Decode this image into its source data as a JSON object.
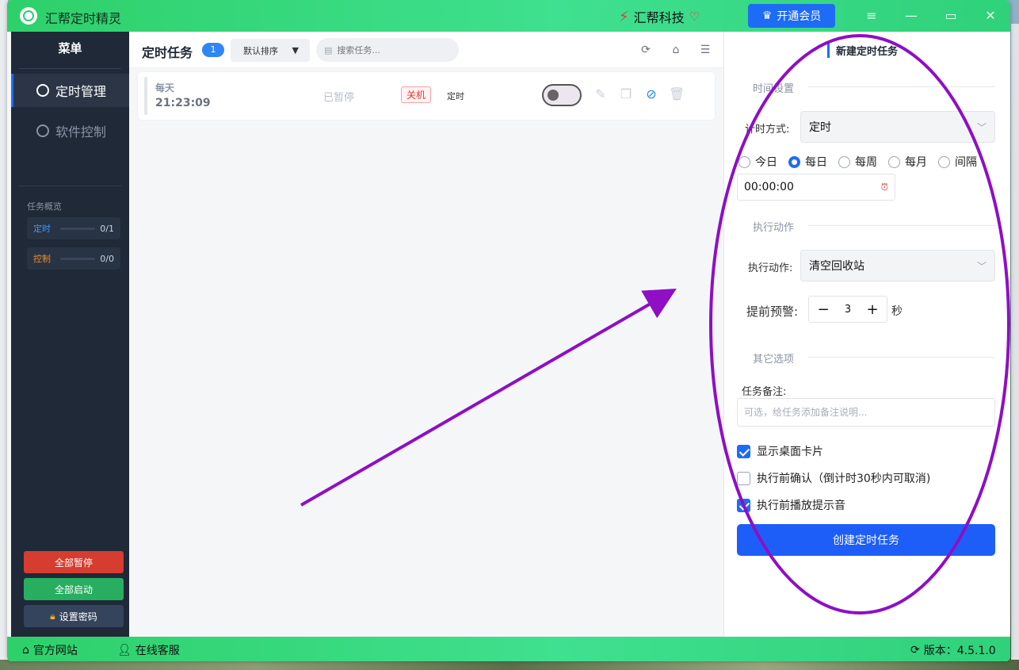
{
  "app": {
    "title": "汇帮定时精灵",
    "brand": "汇帮科技",
    "vip_button": "开通会员",
    "controls": {
      "menu": "≡",
      "minimize": "—",
      "maximize": "▭",
      "close": "✕"
    }
  },
  "sidebar": {
    "title": "菜单",
    "items": [
      {
        "label": "定时管理",
        "icon": "clock-icon",
        "active": true
      },
      {
        "label": "软件控制",
        "icon": "gear-icon",
        "active": false
      }
    ],
    "overview_title": "任务概览",
    "overview": [
      {
        "label": "定时",
        "count": "0/1",
        "color": "#3b9bf5"
      },
      {
        "label": "控制",
        "count": "0/0",
        "color": "#f08a24"
      }
    ],
    "buttons": {
      "pause_all": "全部暂停",
      "start_all": "全部启动",
      "set_password": "设置密码"
    }
  },
  "main": {
    "title": "定时任务",
    "count": "1",
    "sort_label": "默认排序",
    "search_placeholder": "搜索任务...",
    "tasks": [
      {
        "frequency": "每天",
        "time": "21:23:09",
        "status": "已暂停",
        "action": "关机",
        "type": "定时",
        "enabled": false
      }
    ]
  },
  "panel": {
    "title": "新建定时任务",
    "time_section": "时间设置",
    "timing_mode_label": "计时方式:",
    "timing_mode_value": "定时",
    "radios": [
      {
        "label": "今日",
        "checked": false
      },
      {
        "label": "每日",
        "checked": true
      },
      {
        "label": "每周",
        "checked": false
      },
      {
        "label": "每月",
        "checked": false
      },
      {
        "label": "间隔",
        "checked": false
      }
    ],
    "time_value": "00:00:00",
    "action_section": "执行动作",
    "action_label": "执行动作:",
    "action_value": "清空回收站",
    "warning_label": "提前预警:",
    "warning_value": "3",
    "warning_unit": "秒",
    "other_section": "其它选项",
    "remark_label": "任务备注:",
    "remark_placeholder": "可选，给任务添加备注说明...",
    "checks": [
      {
        "label": "显示桌面卡片",
        "checked": true
      },
      {
        "label": "执行前确认（倒计时30秒内可取消)",
        "checked": false
      },
      {
        "label": "执行前播放提示音",
        "checked": true
      }
    ],
    "create_button": "创建定时任务"
  },
  "footer": {
    "website": "官方网站",
    "support": "在线客服",
    "version": "版本：4.5.1.0"
  },
  "colors": {
    "accent": "#1e6cf5",
    "titlebar": "#3fe08f",
    "sidebar": "#1f2937",
    "danger": "#d63c2f",
    "success": "#27ae60",
    "annotation": "#8e0fc4"
  }
}
